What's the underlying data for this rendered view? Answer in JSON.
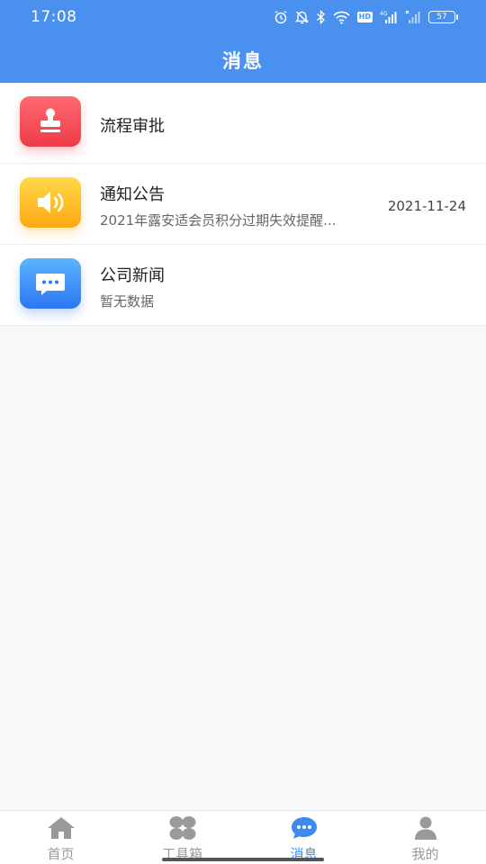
{
  "status_bar": {
    "time": "17:08",
    "hd_label": "HD",
    "network": "4G",
    "battery": "57"
  },
  "header": {
    "title": "消息"
  },
  "messages": [
    {
      "title": "流程审批",
      "preview": "",
      "date": "",
      "icon": "stamp-icon",
      "color": "#ee3b47"
    },
    {
      "title": "通知公告",
      "preview": "2021年露安适会员积分过期失效提醒...",
      "date": "2021-11-24",
      "icon": "speaker-icon",
      "color": "#ffa812"
    },
    {
      "title": "公司新闻",
      "preview": "暂无数据",
      "date": "",
      "icon": "chat-bubble-icon",
      "color": "#2b76f3"
    }
  ],
  "tabs": [
    {
      "label": "首页",
      "icon": "home-icon",
      "active": false
    },
    {
      "label": "工具箱",
      "icon": "toolbox-icon",
      "active": false
    },
    {
      "label": "消息",
      "icon": "message-icon",
      "active": true
    },
    {
      "label": "我的",
      "icon": "person-icon",
      "active": false
    }
  ],
  "colors": {
    "primary": "#4a90ee",
    "tab_active": "#3d8af0",
    "tab_inactive": "#999999"
  }
}
